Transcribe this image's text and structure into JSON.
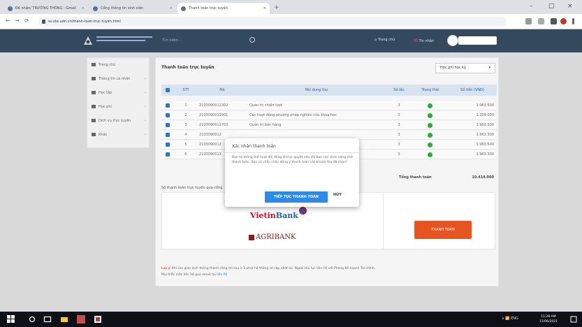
{
  "browser": {
    "tabs": [
      {
        "label": "Đề nhận/ TRƯỜNG THÔNG - Gmail",
        "active": false
      },
      {
        "label": "Cổng thông tin sinh viên",
        "active": false
      },
      {
        "label": "Thanh toán trực tuyến",
        "active": true
      }
    ],
    "new_tab": "+",
    "url": "sv.ute.udn.vn/thanh-toan-truc-tuyen.html",
    "back": "←",
    "forward": "→",
    "reload": "⟳"
  },
  "site": {
    "search_placeholder": "Tìm kiếm...",
    "link_home": "Trang chủ",
    "link_messages": "Tin nhắn"
  },
  "sidebar": {
    "items": [
      {
        "label": "Trang chủ",
        "icon": "home-icon"
      },
      {
        "label": "Thông tin cá nhân",
        "icon": "user-icon"
      },
      {
        "label": "Học tập",
        "icon": "study-icon"
      },
      {
        "label": "Học phí",
        "icon": "fee-icon"
      },
      {
        "label": "Dịch vụ trực tuyến",
        "icon": "service-icon"
      },
      {
        "label": "Khác",
        "icon": "other-icon"
      }
    ]
  },
  "panel": {
    "title": "Thanh toán trực tuyến",
    "select_value": "Học phí học kỳ"
  },
  "table": {
    "headers": [
      "STT",
      "Mã",
      "Nội dung thu",
      "Số lần",
      "Trạng thái",
      "Số tiền (VNĐ)"
    ],
    "rows": [
      {
        "stt": "1",
        "code": "2103090011302",
        "content": "Quản trị chiến lược",
        "count": "3",
        "amount": "1.963.500"
      },
      {
        "stt": "2",
        "code": "2103090011901",
        "content": "Các hoạt động phương pháp nghiên cứu khoa học",
        "count": "3",
        "amount": "1.309.000"
      },
      {
        "stt": "3",
        "code": "2103090011703",
        "content": "Quản trị bán hàng",
        "count": "3",
        "amount": "1.963.500"
      },
      {
        "stt": "4",
        "code": "2103090012",
        "content": "",
        "count": "3",
        "amount": "1.963.500"
      },
      {
        "stt": "5",
        "code": "2103090012",
        "content": "",
        "count": "3",
        "amount": "1.963.500"
      },
      {
        "stt": "6",
        "code": "2103090013",
        "content": "",
        "count": "3",
        "amount": "1.963.500"
      }
    ],
    "total_label": "Tổng thanh toán",
    "total_value": "10.414.000"
  },
  "note_left": "Số thanh toán trực tuyến qua cổng",
  "banks": {
    "vietin_a": "Vietin",
    "vietin_b": "Bank",
    "agri": "AGRIBANK"
  },
  "pay_button": "THANH TOÁN",
  "footnote": {
    "label": "Lưu ý:",
    "line1": "Khi các giao dịch thông thành công thì sau 1-3 phút hệ thống sẽ cập nhật lại. Ngoài thủ tục liên hệ với Phòng Kế hoạch Tài chính.",
    "line2": "Mọi thắc mắc liên hệ qua email tại",
    "link": "liên hệ"
  },
  "modal": {
    "title": "Xác nhận thanh toán",
    "body": "Bạn sẽ thông thể hoạt đối đồng lệ trực quyết nếu chỉ bạn các chức năng chờ thanh toán. Bạn có chắc chắn đồng ý thanh toán các khoản thu đã chọn?",
    "confirm": "TIẾP TỤC THANH TOÁN",
    "cancel": "HỦY"
  },
  "taskbar": {
    "tray": "∧ 📶 ENG",
    "time": "11:28 AM",
    "date": "11/06/2021"
  }
}
